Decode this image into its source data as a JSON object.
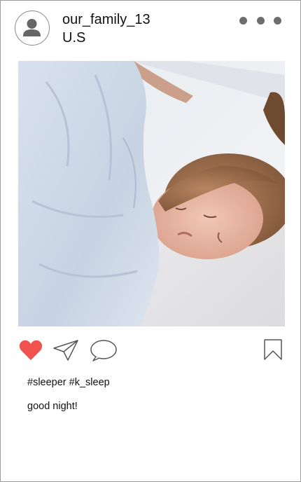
{
  "post": {
    "username": "our_family_13",
    "location": "U.S",
    "hashtags": "#sleeper #k_sleep",
    "caption": "good night!",
    "liked": true,
    "like_color": "#f0534e"
  },
  "icons": {
    "avatar": "user-avatar-icon",
    "more": "more-dots-icon",
    "like": "heart-icon",
    "share": "paper-plane-icon",
    "comment": "speech-bubble-icon",
    "bookmark": "bookmark-icon"
  }
}
